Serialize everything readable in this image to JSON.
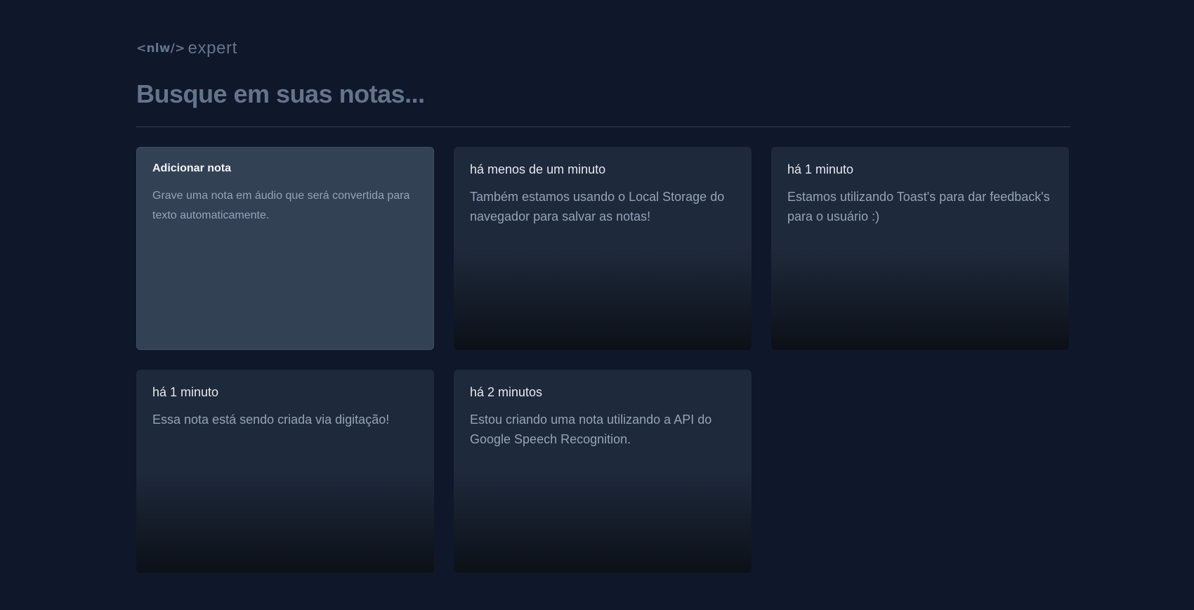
{
  "logo": {
    "code": "<nlw/>",
    "word": "expert"
  },
  "search": {
    "placeholder": "Busque em suas notas..."
  },
  "add_card": {
    "title": "Adicionar nota",
    "description": "Grave uma nota em áudio que será convertida para texto automaticamente."
  },
  "notes": [
    {
      "date": "há menos de um minuto",
      "content": "Também estamos usando o Local Storage do navegador para salvar as notas!"
    },
    {
      "date": "há 1 minuto",
      "content": "Estamos utilizando Toast's para dar feedback's para o usuário :)"
    },
    {
      "date": "há 1 minuto",
      "content": "Essa nota está sendo criada via digitação!"
    },
    {
      "date": "há 2 minutos",
      "content": "Estou criando uma nota utilizando a API do Google Speech Recognition."
    }
  ],
  "colors": {
    "background": "#0f172a",
    "card": "#1e293b",
    "add_card": "#334155",
    "text_muted": "#94a3b8",
    "text_primary": "#e2e8f0",
    "placeholder": "#64748b"
  }
}
